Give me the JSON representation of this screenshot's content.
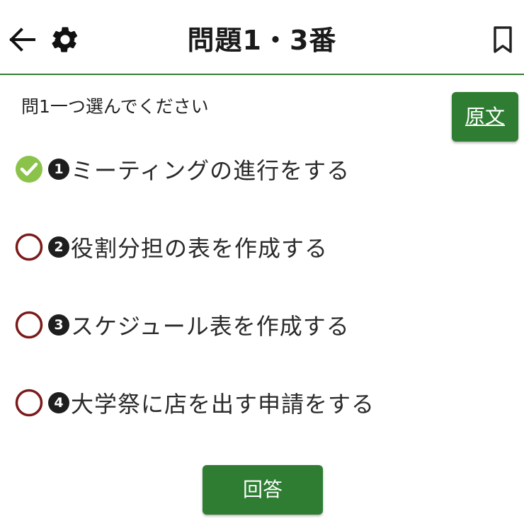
{
  "header": {
    "title": "問題1・3番",
    "back_icon": "arrow-left-icon",
    "settings_icon": "gear-icon",
    "bookmark_icon": "bookmark-icon"
  },
  "question": {
    "instruction": "問1一つ選んでください",
    "source_button_label": "原文"
  },
  "options": [
    {
      "number": "1",
      "text": "ミーティングの進行をする",
      "selected": true
    },
    {
      "number": "2",
      "text": "役割分担の表を作成する",
      "selected": false
    },
    {
      "number": "3",
      "text": "スケジュール表を作成する",
      "selected": false
    },
    {
      "number": "4",
      "text": "大学祭に店を出す申請をする",
      "selected": false
    }
  ],
  "answer_button_label": "回答",
  "colors": {
    "accent": "#2e7d32",
    "selected_check": "#8bc34a",
    "radio_outline": "#7b1a1a"
  }
}
